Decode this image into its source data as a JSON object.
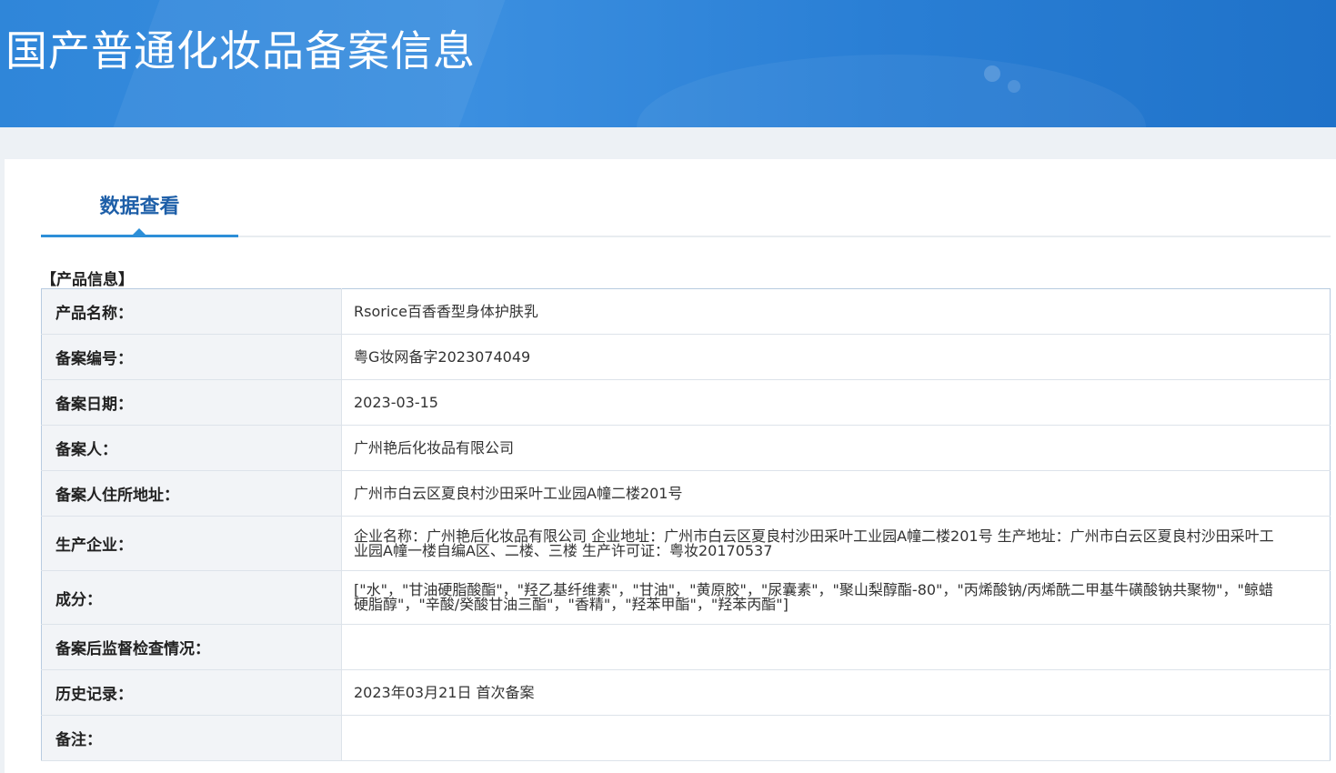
{
  "banner": {
    "title": "国产普通化妆品备案信息"
  },
  "tabs": [
    {
      "label": "数据查看",
      "active": true
    }
  ],
  "section": {
    "title": "【产品信息】"
  },
  "fields": [
    {
      "label": "产品名称：",
      "value": "Rsorice百香香型身体护肤乳"
    },
    {
      "label": "备案编号：",
      "value": "粤G妆网备字2023074049"
    },
    {
      "label": "备案日期：",
      "value": "2023-03-15"
    },
    {
      "label": "备案人：",
      "value": "广州艳后化妆品有限公司"
    },
    {
      "label": "备案人住所地址：",
      "value": "广州市白云区夏良村沙田采叶工业园A幢二楼201号"
    },
    {
      "label": "生产企业：",
      "value": "企业名称：广州艳后化妆品有限公司 企业地址：广州市白云区夏良村沙田采叶工业园A幢二楼201号 生产地址：广州市白云区夏良村沙田采叶工业园A幢一楼自编A区、二楼、三楼 生产许可证：粤妆20170537"
    },
    {
      "label": "成分：",
      "value": "[\"水\"，\"甘油硬脂酸酯\"，\"羟乙基纤维素\"，\"甘油\"，\"黄原胶\"，\"尿囊素\"，\"聚山梨醇酯-80\"，\"丙烯酸钠/丙烯酰二甲基牛磺酸钠共聚物\"，\"鲸蜡硬脂醇\"，\"辛酸/癸酸甘油三酯\"，\"香精\"，\"羟苯甲酯\"，\"羟苯丙酯\"]"
    },
    {
      "label": "备案后监督检查情况：",
      "value": ""
    },
    {
      "label": "历史记录：",
      "value": "2023年03月21日 首次备案"
    },
    {
      "label": "备注：",
      "value": ""
    }
  ],
  "colors": {
    "banner": "#2f86d9",
    "tab_accent": "#2d8fd8",
    "tab_text": "#1e5fa8",
    "label_bg": "#f2f4f7"
  }
}
